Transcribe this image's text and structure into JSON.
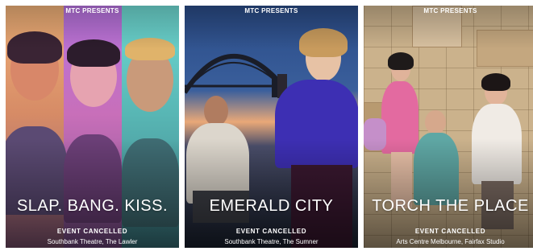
{
  "cards": [
    {
      "presents": "MTC PRESENTS",
      "title": "SLAP. BANG. KISS.",
      "status": "EVENT CANCELLED",
      "venue": "Southbank Theatre, The Lawler",
      "image_icon": "three-faces-image"
    },
    {
      "presents": "MTC PRESENTS",
      "title": "EMERALD CITY",
      "status": "EVENT CANCELLED",
      "venue": "Southbank Theatre, The Sumner",
      "image_icon": "harbour-bridge-image"
    },
    {
      "presents": "MTC PRESENTS",
      "title": "TORCH THE PLACE",
      "status": "EVENT CANCELLED",
      "venue": "Arts Centre Melbourne, Fairfax Studio",
      "image_icon": "boxes-room-image"
    }
  ],
  "colors": {
    "card1_strip_left": "#e9a06f",
    "card1_strip_mid": "#b96fd8",
    "card1_strip_right": "#6ed5d0",
    "card2_sky": "#1f3c73",
    "card2_sunset": "#f0b37a",
    "card3_boxes": "#c9b08a",
    "text": "#ffffff"
  }
}
